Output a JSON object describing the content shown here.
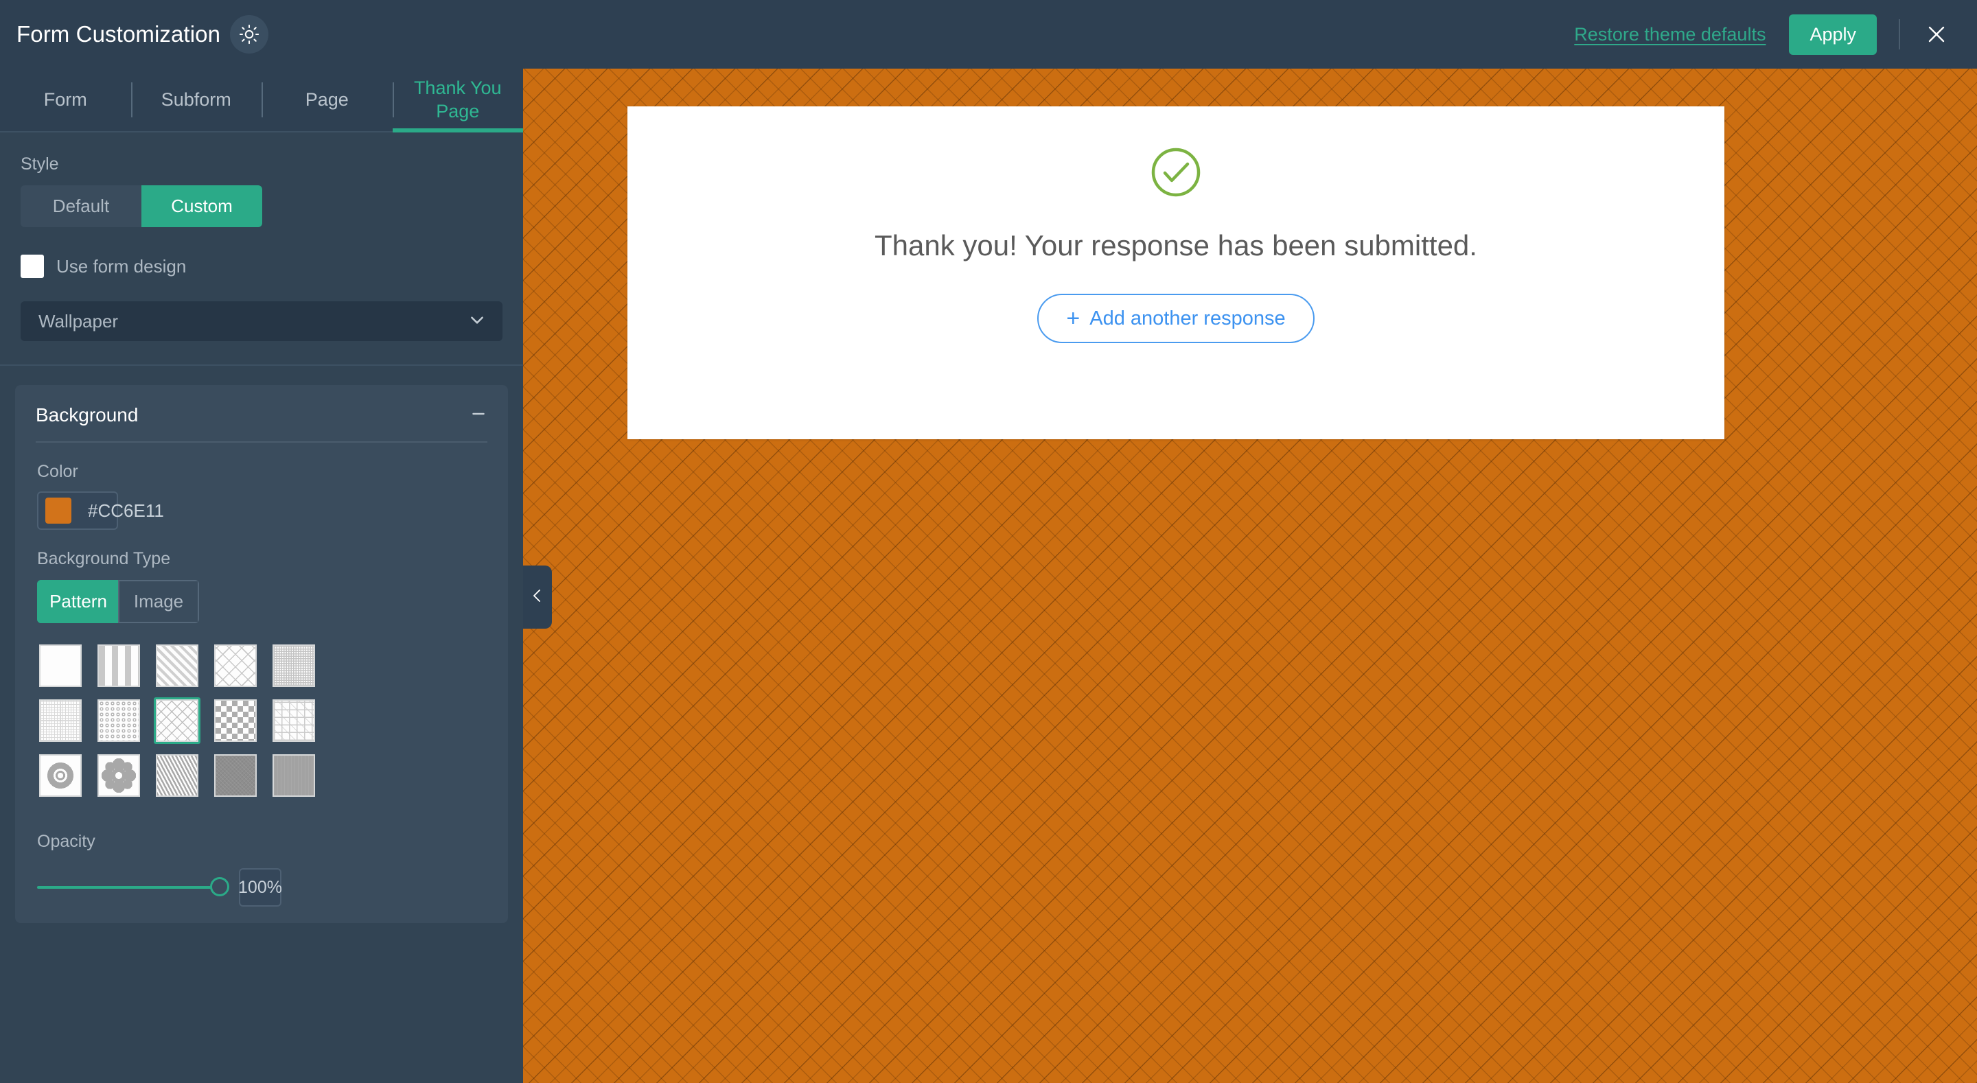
{
  "topbar": {
    "title": "Form Customization",
    "brightness_icon": "sun-brightness-icon",
    "restore_link": "Restore theme defaults",
    "apply_label": "Apply",
    "close_icon": "close-x-icon"
  },
  "tabs": [
    {
      "label": "Form",
      "active": false
    },
    {
      "label": "Subform",
      "active": false
    },
    {
      "label": "Page",
      "active": false
    },
    {
      "label": "Thank You Page",
      "active": true
    }
  ],
  "style": {
    "label": "Style",
    "options": [
      {
        "label": "Default",
        "active": false
      },
      {
        "label": "Custom",
        "active": true
      }
    ]
  },
  "use_form_design": {
    "label": "Use form design",
    "checked": false
  },
  "wallpaper": {
    "label": "Wallpaper",
    "chevron_icon": "chevron-down-icon"
  },
  "background": {
    "title": "Background",
    "collapse_icon": "minus-icon",
    "color": {
      "label": "Color",
      "value": "#CC6E11",
      "swatch_hex": "#D2731A"
    },
    "background_type": {
      "label": "Background Type",
      "options": [
        {
          "label": "Pattern",
          "active": true
        },
        {
          "label": "Image",
          "active": false
        }
      ]
    },
    "patterns": [
      {
        "name": "plain-white",
        "selected": false
      },
      {
        "name": "vertical-stripes",
        "selected": false
      },
      {
        "name": "diagonal-stripes",
        "selected": false
      },
      {
        "name": "diamond-lattice",
        "selected": false
      },
      {
        "name": "small-squares-grid",
        "selected": false
      },
      {
        "name": "fine-grid-quadrants",
        "selected": false
      },
      {
        "name": "dotted-circles",
        "selected": false
      },
      {
        "name": "diagonal-basketweave",
        "selected": true
      },
      {
        "name": "checkerboard",
        "selected": false
      },
      {
        "name": "square-diamond-mix",
        "selected": false
      },
      {
        "name": "floral-starburst",
        "selected": false
      },
      {
        "name": "flower-rosette",
        "selected": false
      },
      {
        "name": "ornate-damask",
        "selected": false
      },
      {
        "name": "gray-texture-dense",
        "selected": false
      },
      {
        "name": "gray-texture-soft",
        "selected": false
      }
    ],
    "opacity": {
      "label": "Opacity",
      "value": "100%",
      "percent": 100
    }
  },
  "preview": {
    "collapse_icon": "chevron-left-icon",
    "background_color": "#CC6E11",
    "check_icon": "circle-check-icon",
    "check_icon_color": "#7CB342",
    "thank_you_text": "Thank you! Your response has been submitted.",
    "add_response_label": "Add another response",
    "add_response_icon": "plus-icon"
  }
}
